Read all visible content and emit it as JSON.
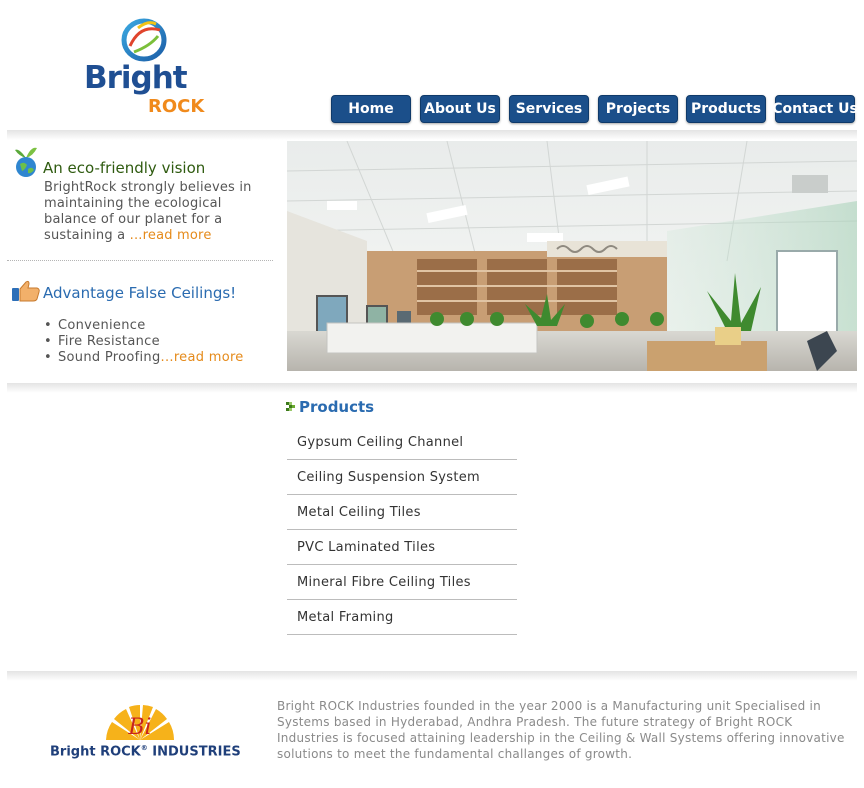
{
  "logo": {
    "word1": "Bright",
    "word2": "ROCK"
  },
  "nav": {
    "items": [
      {
        "label": "Home"
      },
      {
        "label": "About Us"
      },
      {
        "label": "Services"
      },
      {
        "label": "Projects"
      },
      {
        "label": "Products"
      },
      {
        "label": "Contact Us"
      }
    ]
  },
  "eco": {
    "title": "An eco-friendly vision",
    "text": "BrightRock strongly believes in maintaining the ecological balance of our planet for a sustaining a ",
    "link": "...read more"
  },
  "advantage": {
    "title": "Advantage False Ceilings!",
    "items": [
      "Convenience",
      "Fire Resistance",
      "Sound Proofing"
    ],
    "link": "...read more"
  },
  "products": {
    "title": "Products",
    "items": [
      "Gypsum Ceiling Channel",
      "Ceiling Suspension System",
      "Metal Ceiling Tiles",
      "PVC Laminated Tiles",
      "Mineral Fibre Ceiling Tiles",
      "Metal Framing"
    ]
  },
  "footer": {
    "logo_mark": "Bi",
    "logo_name_1": "Bright ROCK",
    "logo_reg": "®",
    "logo_name_2": "INDUSTRIES",
    "text": "Bright ROCK Industries founded in the year 2000 is a Manufacturing unit Specialised in Systems based in Hyderabad, Andhra Pradesh. The future strategy of Bright ROCK Industries is focused attaining leadership in the Ceiling & Wall Systems offering innovative solutions to meet the fundamental challanges of growth."
  },
  "colors": {
    "nav_bg": "#1b4f8a",
    "brand_blue": "#1f4f93",
    "brand_orange": "#f08a1c",
    "eco_green": "#2f5b10",
    "link_orange": "#e58a1a"
  }
}
